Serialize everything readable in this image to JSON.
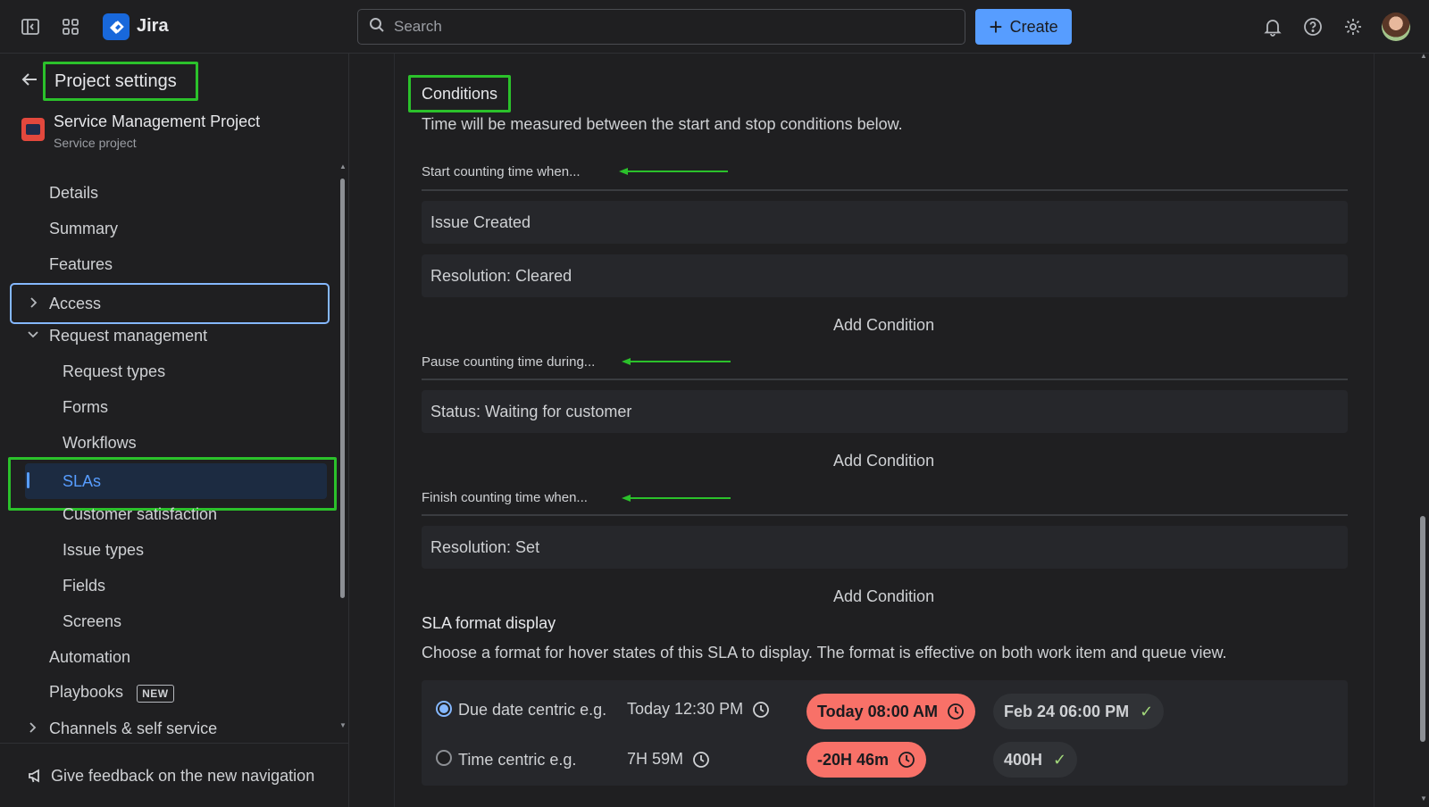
{
  "topbar": {
    "app_name": "Jira",
    "search_placeholder": "Search",
    "create_label": "Create"
  },
  "sidebar": {
    "title": "Project settings",
    "project_name": "Service Management Project",
    "project_type": "Service project",
    "items": [
      {
        "label": "Details"
      },
      {
        "label": "Summary"
      },
      {
        "label": "Features"
      },
      {
        "label": "Access"
      },
      {
        "label": "Request management"
      },
      {
        "label": "Request types"
      },
      {
        "label": "Forms"
      },
      {
        "label": "Workflows"
      },
      {
        "label": "SLAs"
      },
      {
        "label": "Customer satisfaction"
      },
      {
        "label": "Issue types"
      },
      {
        "label": "Fields"
      },
      {
        "label": "Screens"
      },
      {
        "label": "Automation"
      },
      {
        "label": "Playbooks",
        "badge": "NEW"
      },
      {
        "label": "Channels & self service"
      }
    ],
    "feedback_label": "Give feedback on the new navigation"
  },
  "main": {
    "conditions_title": "Conditions",
    "conditions_desc": "Time will be measured between the start and stop conditions below.",
    "start": {
      "heading": "Start counting time when...",
      "conditions": [
        "Issue Created",
        "Resolution: Cleared"
      ],
      "add_label": "Add Condition"
    },
    "pause": {
      "heading": "Pause counting time during...",
      "conditions": [
        "Status: Waiting for customer"
      ],
      "add_label": "Add Condition"
    },
    "finish": {
      "heading": "Finish counting time when...",
      "conditions": [
        "Resolution: Set"
      ],
      "add_label": "Add Condition"
    },
    "sla_format": {
      "title": "SLA format display",
      "desc": "Choose a format for hover states of this SLA to display. The format is effective on both work item and queue view.",
      "options": [
        {
          "label": "Due date centric e.g.",
          "checked": true,
          "example_plain": "Today 12:30 PM",
          "example_breached": "Today 08:00 AM",
          "example_met": "Feb 24 06:00 PM"
        },
        {
          "label": "Time centric e.g.",
          "checked": false,
          "example_plain": "7H 59M",
          "example_breached": "-20H 46m",
          "example_met": "400H"
        }
      ]
    }
  },
  "colors": {
    "accent": "#579dff",
    "highlight_box": "#2bc12b",
    "breached_pill": "#f87168",
    "met_check": "#a3d97b"
  }
}
